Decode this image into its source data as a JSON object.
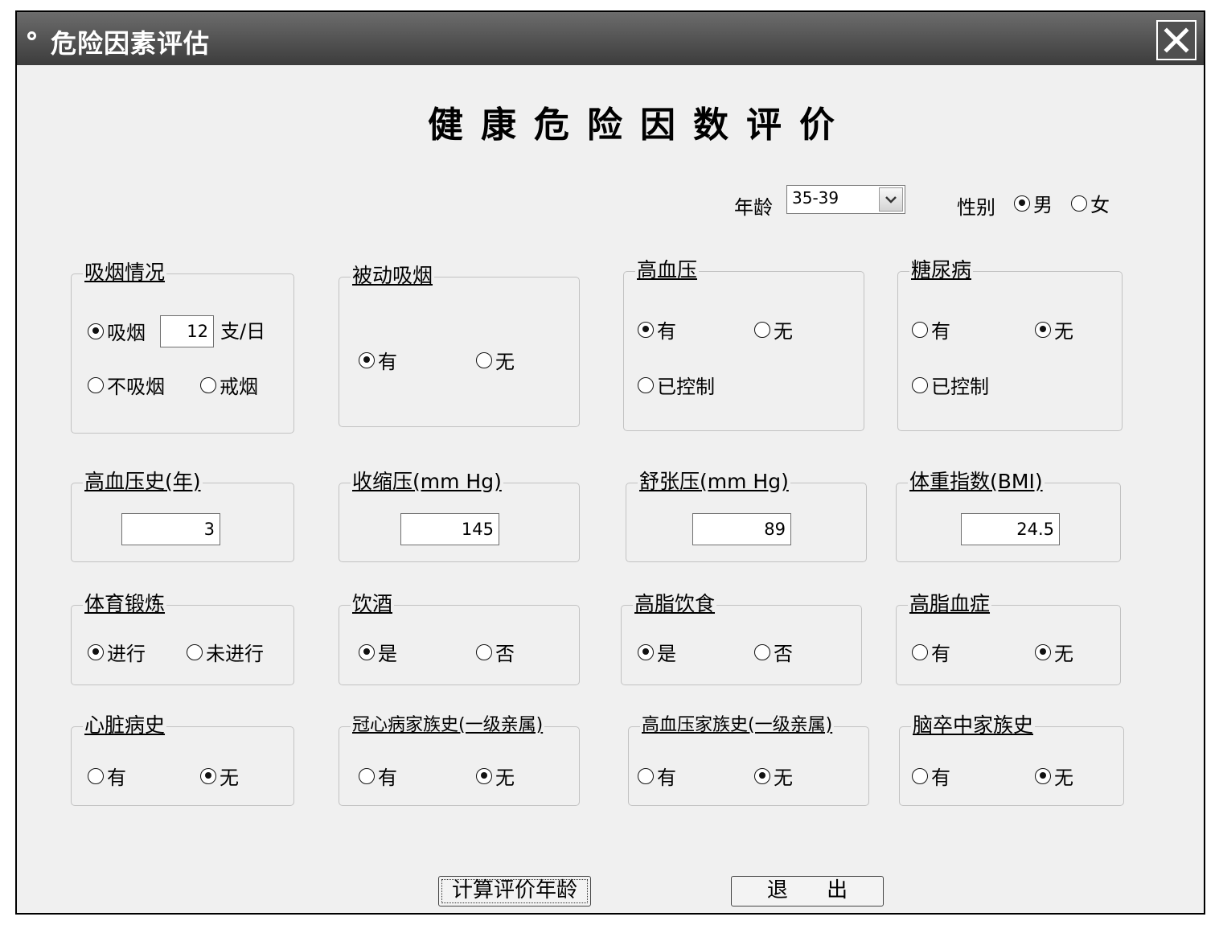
{
  "window": {
    "title": "危险因素评估"
  },
  "form": {
    "title": "健康危险因数评价",
    "age": {
      "label": "年龄",
      "value": "35-39"
    },
    "gender": {
      "label": "性别",
      "male": "男",
      "female": "女",
      "selected": "男"
    }
  },
  "groups": {
    "smoking": {
      "legend": "吸烟情况",
      "smoke": "吸烟",
      "amount": "12",
      "unit": "支/日",
      "no_smoke": "不吸烟",
      "quit": "戒烟",
      "selected": "吸烟"
    },
    "passive_smoking": {
      "legend": "被动吸烟",
      "yes": "有",
      "no": "无",
      "selected": "有"
    },
    "hypertension": {
      "legend": "高血压",
      "yes": "有",
      "no": "无",
      "controlled": "已控制",
      "selected": "有"
    },
    "diabetes": {
      "legend": "糖尿病",
      "yes": "有",
      "no": "无",
      "controlled": "已控制",
      "selected": "无"
    },
    "hypertension_years": {
      "legend": "高血压史(年)",
      "value": "3"
    },
    "systolic": {
      "legend": "收缩压(mm Hg)",
      "value": "145"
    },
    "diastolic": {
      "legend": "舒张压(mm Hg)",
      "value": "89"
    },
    "bmi": {
      "legend": "体重指数(BMI)",
      "value": "24.5"
    },
    "exercise": {
      "legend": "体育锻炼",
      "yes": "进行",
      "no": "未进行",
      "selected": "进行"
    },
    "drinking": {
      "legend": "饮酒",
      "yes": "是",
      "no": "否",
      "selected": "是"
    },
    "high_fat_diet": {
      "legend": "高脂饮食",
      "yes": "是",
      "no": "否",
      "selected": "是"
    },
    "hyperlipidemia": {
      "legend": "高脂血症",
      "yes": "有",
      "no": "无",
      "selected": "无"
    },
    "heart_history": {
      "legend": "心脏病史",
      "yes": "有",
      "no": "无",
      "selected": "无"
    },
    "chd_family": {
      "legend": "冠心病家族史(一级亲属)",
      "yes": "有",
      "no": "无",
      "selected": "无"
    },
    "htn_family": {
      "legend": "高血压家族史(一级亲属)",
      "yes": "有",
      "no": "无",
      "selected": "无"
    },
    "stroke_family": {
      "legend": "脑卒中家族史",
      "yes": "有",
      "no": "无",
      "selected": "无"
    }
  },
  "buttons": {
    "calculate": "计算评价年龄",
    "exit": "退 出"
  },
  "icons": {
    "title": "circle-dot-icon",
    "close": "close-icon",
    "dropdown": "chevron-down-icon"
  },
  "colors": {
    "titlebar": "#4a4a4a",
    "window_bg": "#f0f0f0",
    "group_border": "#c2c2c2"
  }
}
